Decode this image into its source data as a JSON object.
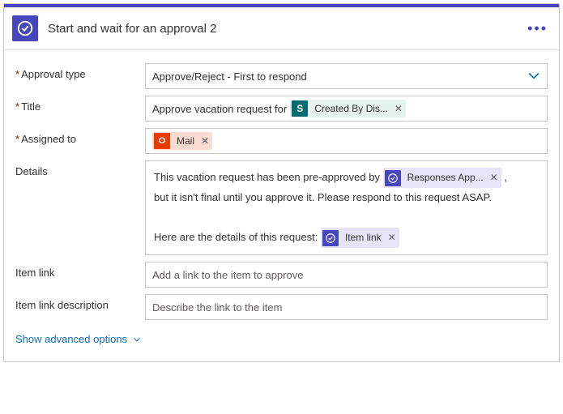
{
  "header": {
    "title": "Start and wait for an approval 2"
  },
  "fields": {
    "approval_type": {
      "label": "Approval type",
      "required": true,
      "value": "Approve/Reject - First to respond"
    },
    "title_field": {
      "label": "Title",
      "required": true,
      "prefix_text": "Approve vacation request for ",
      "token": {
        "icon": "S",
        "label": "Created By Dis..."
      }
    },
    "assigned_to": {
      "label": "Assigned to",
      "required": true,
      "token": {
        "icon": "O",
        "label": "Mail"
      }
    },
    "details": {
      "label": "Details",
      "required": false,
      "text1": "This vacation request has been pre-approved by ",
      "token1": {
        "label": "Responses App..."
      },
      "text1b": " ,",
      "text2": "but it isn't final until you approve it. Please respond to this request ASAP.",
      "text3": "Here are the details of this request: ",
      "token2": {
        "label": "Item link"
      }
    },
    "item_link": {
      "label": "Item link",
      "required": false,
      "placeholder": "Add a link to the item to approve"
    },
    "item_link_desc": {
      "label": "Item link description",
      "required": false,
      "placeholder": "Describe the link to the item"
    }
  },
  "advanced": {
    "label": "Show advanced options"
  }
}
